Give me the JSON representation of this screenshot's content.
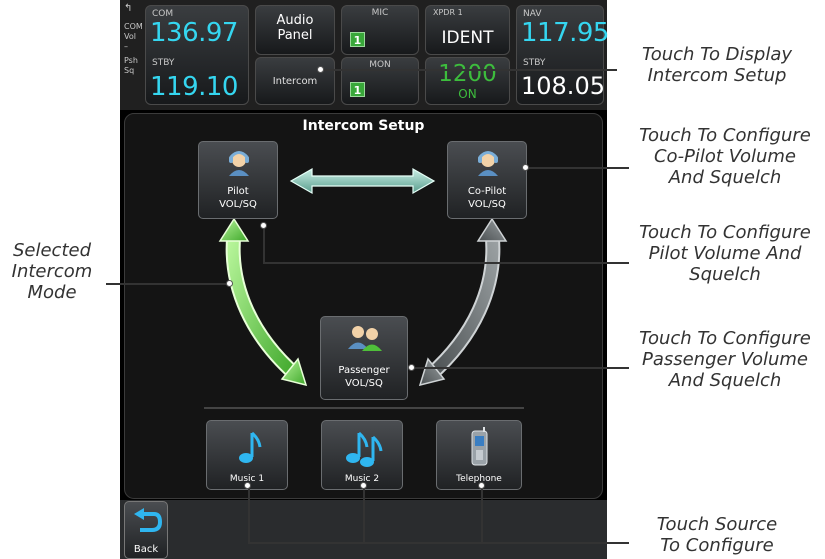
{
  "header": {
    "com_label": "COM",
    "side_vol": "Vol",
    "side_push": "Psh",
    "side_sq": "Sq",
    "com_active": "136.97",
    "com_stby_label": "STBY",
    "com_stby": "119.10",
    "audio_panel": "Audio\nPanel",
    "intercom": "Intercom",
    "mic_label": "MIC",
    "mic_value": "1",
    "mon_label": "MON",
    "mon_value": "1",
    "xpdr_label": "XPDR 1",
    "xpdr_ident": "IDENT",
    "xpdr_code": "1200",
    "xpdr_mode": "ON",
    "nav_label": "NAV",
    "nav_active": "117.95",
    "nav_stby_label": "STBY",
    "nav_stby": "108.05"
  },
  "panel": {
    "title": "Intercom Setup",
    "pilot_label_1": "Pilot",
    "pilot_label_2": "VOL/SQ",
    "copilot_label_1": "Co-Pilot",
    "copilot_label_2": "VOL/SQ",
    "passenger_label_1": "Passenger",
    "passenger_label_2": "VOL/SQ",
    "music1": "Music 1",
    "music2": "Music 2",
    "telephone": "Telephone"
  },
  "footer": {
    "back": "Back"
  },
  "callouts": {
    "intercom_setup": [
      "Touch To Display",
      "Intercom Setup"
    ],
    "copilot": [
      "Touch To Configure",
      "Co-Pilot Volume",
      "And Squelch"
    ],
    "pilot": [
      "Touch To Configure",
      "Pilot Volume And",
      "Squelch"
    ],
    "passenger": [
      "Touch To Configure",
      "Passenger Volume",
      "And Squelch"
    ],
    "selected_mode": [
      "Selected",
      "Intercom",
      "Mode"
    ],
    "source": [
      "Touch Source",
      "To Configure"
    ]
  },
  "colors": {
    "active_cyan": "#35d6f0",
    "selected_green": "#4fbf3a",
    "arrow_teal": "#8ad2c3"
  }
}
